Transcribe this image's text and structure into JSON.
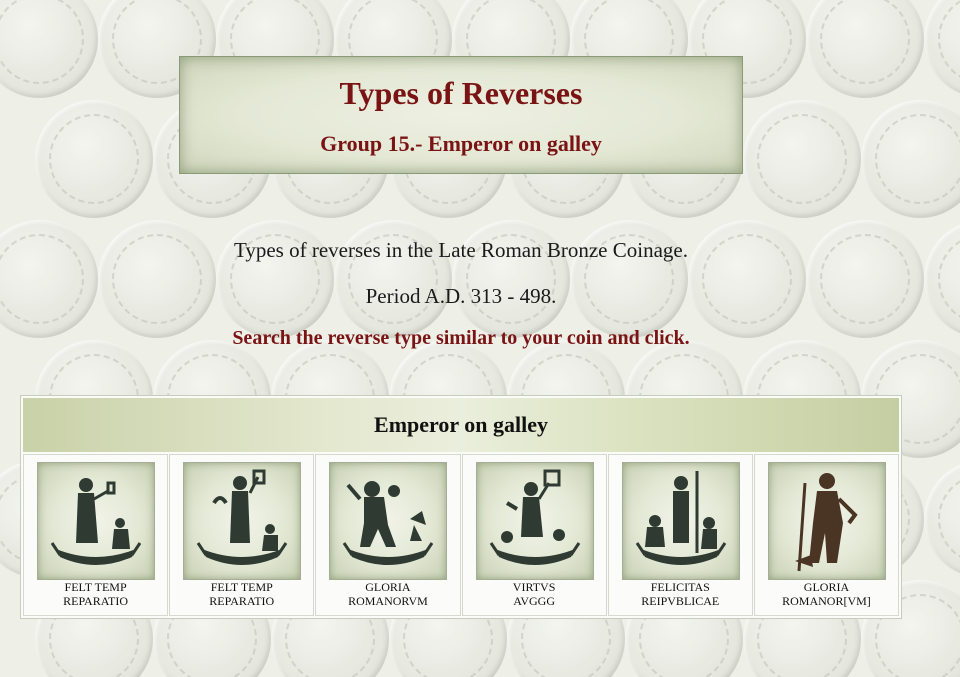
{
  "header": {
    "title": "Types of Reverses",
    "subtitle": "Group 15.- Emperor on galley"
  },
  "intro": {
    "line1": "Types of reverses in the Late Roman Bronze Coinage.",
    "line2": "Period A.D. 313 - 498.",
    "instruction": "Search the reverse type similar to your coin and click."
  },
  "table": {
    "heading": "Emperor on galley",
    "items": [
      {
        "line1": "FELT TEMP",
        "line2": "REPARATIO",
        "icon": "emperor-phoenix-galley-icon"
      },
      {
        "line1": "FELT TEMP",
        "line2": "REPARATIO",
        "icon": "emperor-labarum-galley-icon"
      },
      {
        "line1": "GLORIA",
        "line2": "ROMANORVM",
        "icon": "emperor-victory-galley-icon"
      },
      {
        "line1": "VIRTVS",
        "line2": "AVGGG",
        "icon": "emperor-standard-galley-icon"
      },
      {
        "line1": "FELICITAS",
        "line2": "REIPVBLICAE",
        "icon": "emperor-spear-galley-icon"
      },
      {
        "line1": "GLORIA",
        "line2": "ROMANOR[VM]",
        "icon": "emperor-bronze-figure-icon"
      }
    ]
  },
  "colors": {
    "title_text": "#7a1414",
    "background": "#eef0e8",
    "coin_dark": "#2f3b32",
    "coin_bronze": "#4a3424"
  }
}
